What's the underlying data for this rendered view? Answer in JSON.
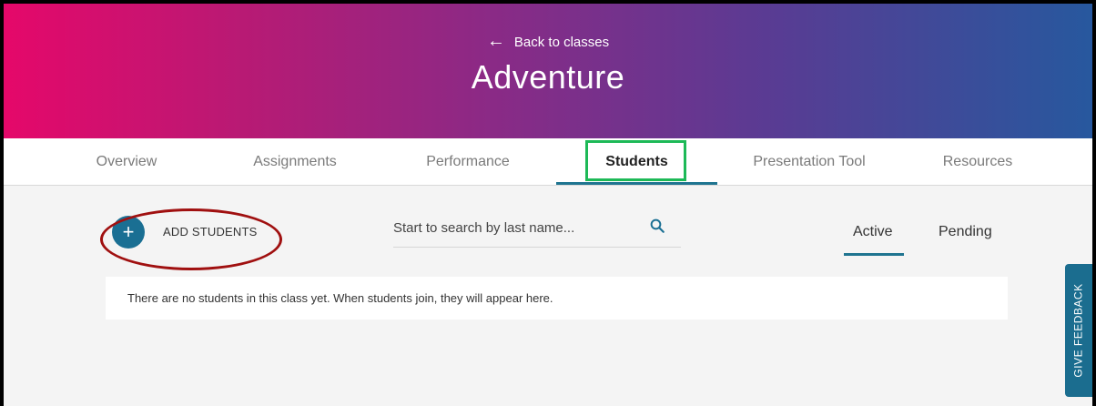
{
  "header": {
    "back_link": "Back to classes",
    "title": "Adventure"
  },
  "tabs": [
    {
      "label": "Overview"
    },
    {
      "label": "Assignments"
    },
    {
      "label": "Performance"
    },
    {
      "label": "Students"
    },
    {
      "label": "Presentation Tool"
    },
    {
      "label": "Resources"
    }
  ],
  "active_tab": "Students",
  "students": {
    "add_label": "ADD STUDENTS",
    "search_placeholder": "Start to search by last name...",
    "status_tabs": [
      {
        "label": "Active"
      },
      {
        "label": "Pending"
      }
    ],
    "active_status": "Active",
    "empty_message": "There are no students in this class yet. When students join, they will appear here."
  },
  "feedback_label": "GIVE FEEDBACK",
  "colors": {
    "accent": "#1a6f93",
    "highlight_box": "#1db957",
    "annotation_circle": "#a01010"
  }
}
